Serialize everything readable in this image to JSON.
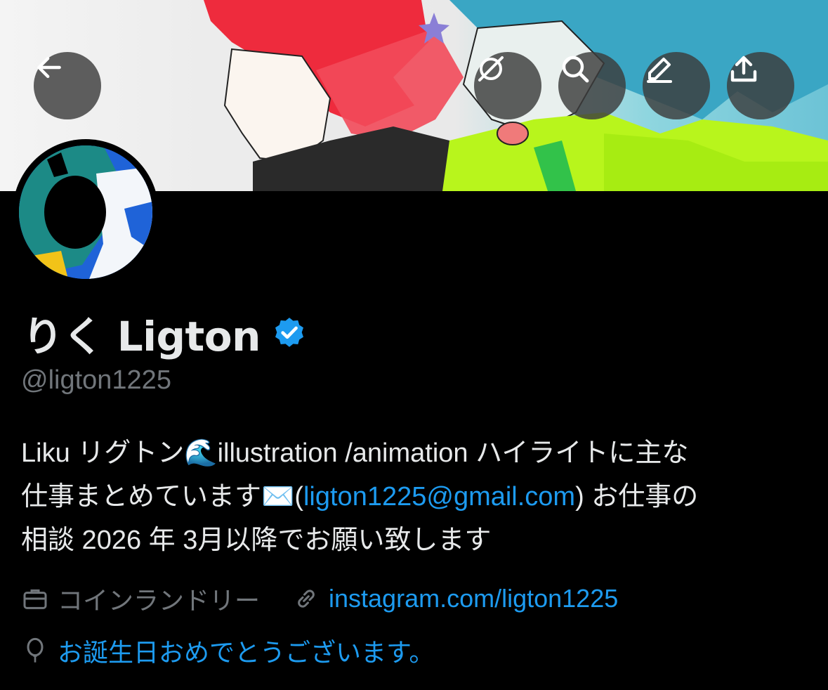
{
  "profile": {
    "display_name": "りく Ligton",
    "handle": "@ligton1225",
    "verified": true,
    "bio_line1": "Liku リグトン🌊illustration /animation ハイライトに主な",
    "bio_line2_pre": "仕事まとめています✉️(",
    "bio_email": "ligton1225@gmail.com",
    "bio_line2_post": ") お仕事の",
    "bio_line3": "相談 2026 年 3月以降でお願い致します",
    "category": "コインランドリー",
    "website": "instagram.com/ligton1225",
    "birthday_text": "お誕生日おめでとうございます。"
  },
  "header_buttons": {
    "back": "arrow-left-icon",
    "grok": "grok-icon",
    "search": "search-icon",
    "edit": "pencil-icon",
    "share": "share-icon"
  },
  "colors": {
    "background": "#000000",
    "primary_text": "#e7e9ea",
    "secondary_text": "#71767b",
    "link": "#1d9bf0",
    "verified": "#1d9bf0"
  }
}
